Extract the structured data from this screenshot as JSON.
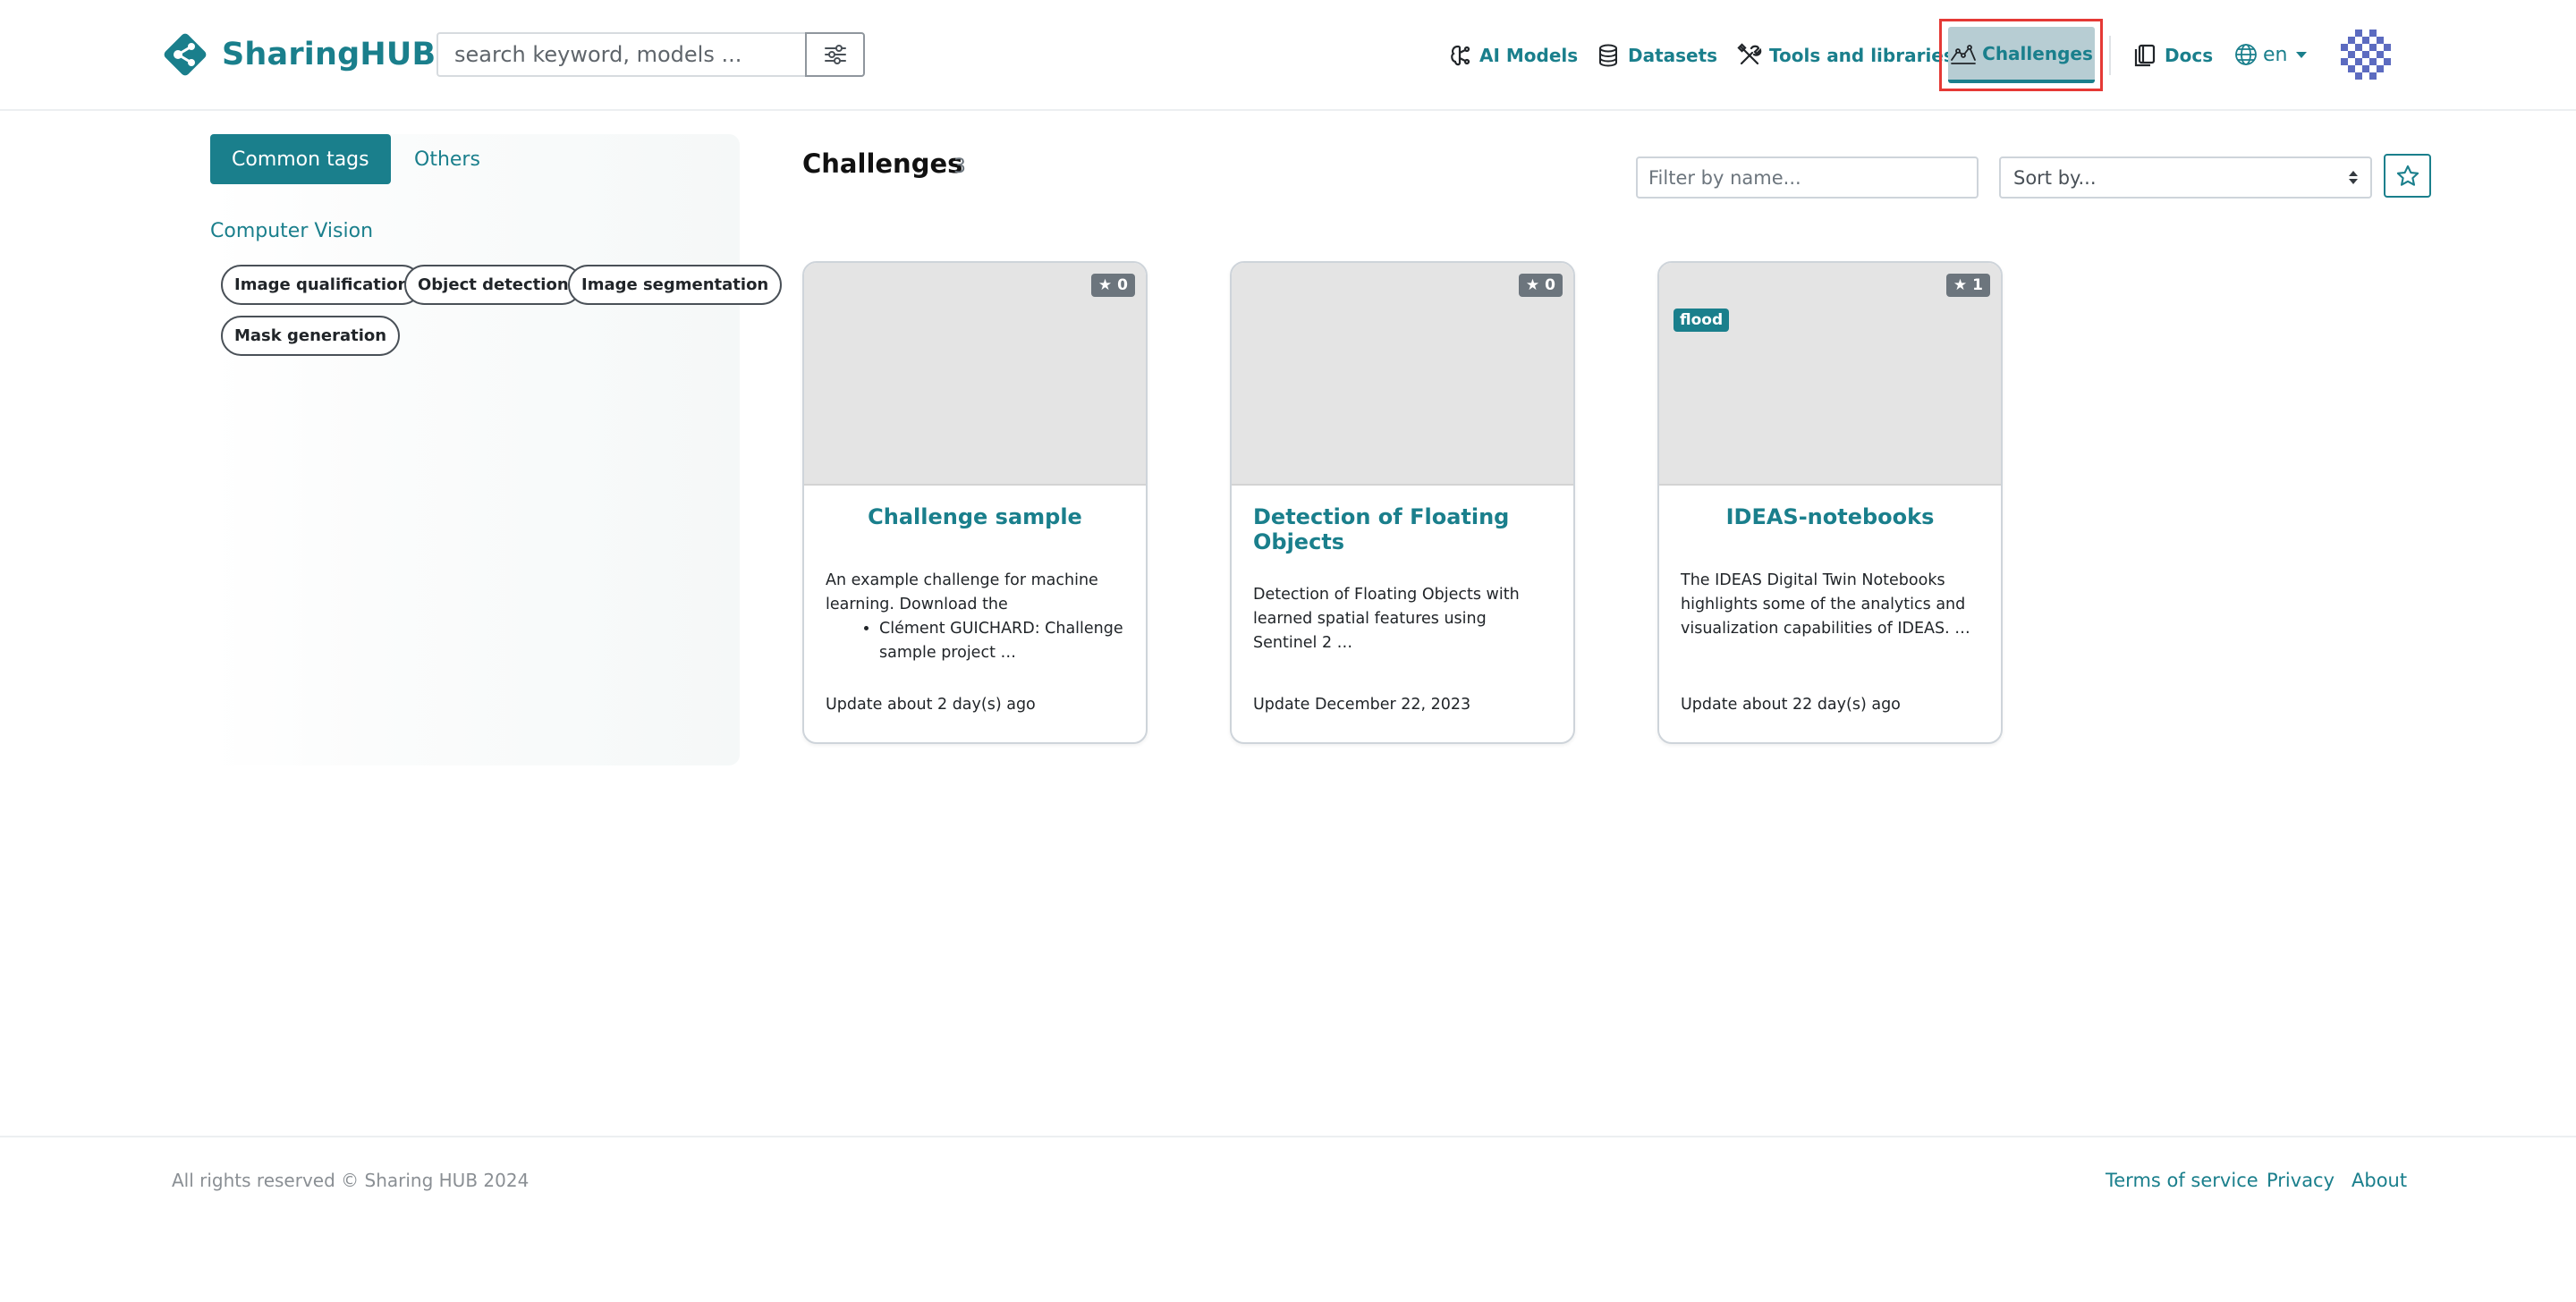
{
  "header": {
    "logo_text": "SharingHUB",
    "search_placeholder": "search keyword, models ...",
    "nav": [
      {
        "label": "AI Models",
        "icon": "ai-models-icon"
      },
      {
        "label": "Datasets",
        "icon": "database-icon"
      },
      {
        "label": "Tools and libraries",
        "icon": "tools-icon"
      },
      {
        "label": "Challenges",
        "icon": "challenges-icon",
        "active": true
      },
      {
        "label": "Docs",
        "icon": "docs-icon"
      }
    ],
    "language": "en"
  },
  "sidebar": {
    "tabs": [
      "Common tags",
      "Others"
    ],
    "active_tab": "Common tags",
    "section_title": "Computer Vision",
    "tags": [
      "Image qualification",
      "Object detection",
      "Image segmentation",
      "Mask generation"
    ]
  },
  "main": {
    "title": "Challenges",
    "count": "3",
    "filter_placeholder": "Filter by name...",
    "sort_placeholder": "Sort by..."
  },
  "cards": [
    {
      "title": "Challenge sample",
      "stars": "0",
      "keyword": "",
      "desc_text": "An example challenge for machine learning. Download the",
      "desc_bullet": "Clément GUICHARD: Challenge sample project …",
      "update": "Update about 2 day(s) ago"
    },
    {
      "title": "Detection of Floating Objects",
      "stars": "0",
      "keyword": "",
      "desc_text": "Detection of Floating Objects with learned spatial features using Sentinel 2 …",
      "desc_bullet": "",
      "update": "Update December 22, 2023"
    },
    {
      "title": "IDEAS-notebooks",
      "stars": "1",
      "keyword": "flood",
      "desc_text": "The IDEAS Digital Twin Notebooks highlights some of the analytics and visualization capabilities of IDEAS. …",
      "desc_bullet": "",
      "update": "Update about 22 day(s) ago"
    }
  ],
  "footer": {
    "copyright": "All rights reserved © Sharing HUB 2024",
    "links": [
      "Terms of service",
      "Privacy",
      "About"
    ]
  },
  "colors": {
    "accent": "#1a7f8c",
    "active_nav_bg": "#b7cdd3",
    "highlight_border": "#e53935",
    "card_image_bg": "#e4e4e4"
  }
}
